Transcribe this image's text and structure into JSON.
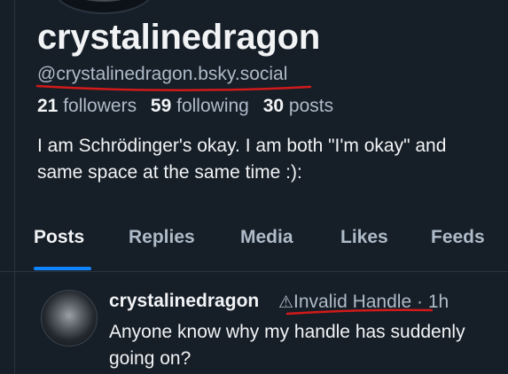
{
  "profile": {
    "display_name": "crystalinedragon",
    "handle": "@crystalinedragon.bsky.social",
    "followers_count": "21",
    "followers_label": "followers",
    "following_count": "59",
    "following_label": "following",
    "posts_count": "30",
    "posts_label": "posts",
    "bio": "I am Schrödinger's okay. I am both \"I'm okay\" and\nsame space at the same time :):"
  },
  "tabs": [
    {
      "label": "Posts",
      "active": true
    },
    {
      "label": "Replies"
    },
    {
      "label": "Media"
    },
    {
      "label": "Likes"
    },
    {
      "label": "Feeds"
    }
  ],
  "post": {
    "author": "crystalinedragon",
    "warning_icon": "warning-triangle-icon",
    "invalid_handle": "Invalid Handle",
    "separator": "·",
    "time": "1h",
    "text": "Anyone know why my handle has suddenly\ngoing on?"
  },
  "colors": {
    "background": "#161e27",
    "accent": "#1185fe",
    "annotation": "#d11a1a"
  }
}
